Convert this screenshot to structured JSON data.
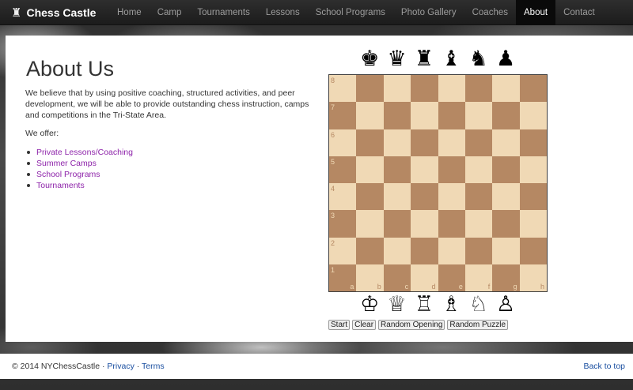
{
  "brand": {
    "name": "Chess Castle",
    "icon": "♜"
  },
  "nav": {
    "items": [
      {
        "label": "Home"
      },
      {
        "label": "Camp"
      },
      {
        "label": "Tournaments"
      },
      {
        "label": "Lessons"
      },
      {
        "label": "School Programs"
      },
      {
        "label": "Photo Gallery"
      },
      {
        "label": "Coaches"
      },
      {
        "label": "About"
      },
      {
        "label": "Contact"
      }
    ],
    "active": "About"
  },
  "about": {
    "title": "About Us",
    "intro": "We believe that by using positive coaching, structured activities, and peer development, we will be able to provide outstanding chess instruction, camps and competitions in the Tri-State Area.",
    "offer_label": "We offer:",
    "links": [
      "Private Lessons/Coaching",
      "Summer Camps",
      "School Programs",
      "Tournaments"
    ]
  },
  "board": {
    "black_pieces": [
      "♚",
      "♛",
      "♜",
      "♝",
      "♞",
      "♟"
    ],
    "white_pieces": [
      "♔",
      "♕",
      "♖",
      "♗",
      "♘",
      "♙"
    ],
    "ranks": [
      "8",
      "7",
      "6",
      "5",
      "4",
      "3",
      "2",
      "1"
    ],
    "files": [
      "a",
      "b",
      "c",
      "d",
      "e",
      "f",
      "g",
      "h"
    ],
    "light_color": "#f0d9b5",
    "dark_color": "#b58863"
  },
  "buttons": {
    "start": "Start",
    "clear": "Clear",
    "random_opening": "Random Opening",
    "random_puzzle": "Random Puzzle"
  },
  "footer": {
    "copyright": "© 2014 NYChessCastle ·",
    "privacy": "Privacy",
    "sep": "·",
    "terms": "Terms",
    "back_to_top": "Back to top"
  }
}
